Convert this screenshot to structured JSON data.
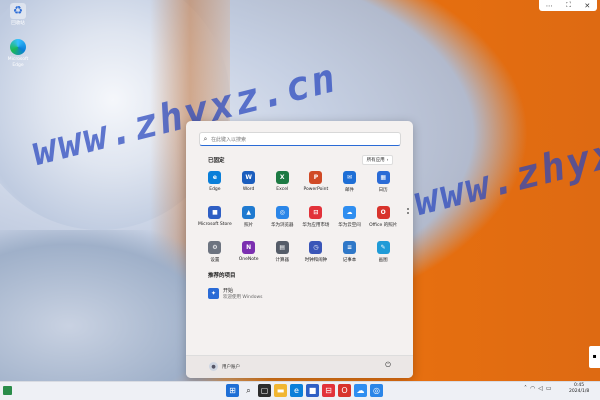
{
  "desktop": {
    "icons": [
      {
        "label": "回收站"
      },
      {
        "label": "Microsoft Edge"
      }
    ],
    "watermark": "www.zhyxz.cn"
  },
  "start_menu": {
    "search_placeholder": "在此键入以搜索",
    "pinned_title": "已固定",
    "all_apps_label": "所有应用",
    "pinned": [
      {
        "label": "Edge",
        "icon": "edge-icon",
        "color": "#0a7fd9",
        "glyph": "e"
      },
      {
        "label": "Word",
        "icon": "word-icon",
        "color": "#1b5ebe",
        "glyph": "W"
      },
      {
        "label": "Excel",
        "icon": "excel-icon",
        "color": "#1d7a43",
        "glyph": "X"
      },
      {
        "label": "PowerPoint",
        "icon": "powerpoint-icon",
        "color": "#d04a26",
        "glyph": "P"
      },
      {
        "label": "邮件",
        "icon": "mail-icon",
        "color": "#1e6fd6",
        "glyph": "✉"
      },
      {
        "label": "日历",
        "icon": "calendar-icon",
        "color": "#2a6bd6",
        "glyph": "▦"
      },
      {
        "label": "Microsoft Store",
        "icon": "store-icon",
        "color": "#2f5fc4",
        "glyph": "■"
      },
      {
        "label": "照片",
        "icon": "photos-icon",
        "color": "#1f7ad0",
        "glyph": "▲"
      },
      {
        "label": "华为浏览器",
        "icon": "huawei-browser-icon",
        "color": "#2b86e8",
        "glyph": "◎"
      },
      {
        "label": "华为应用市场",
        "icon": "huawei-appgallery-icon",
        "color": "#e2323a",
        "glyph": "⊟"
      },
      {
        "label": "华为云空间",
        "icon": "huawei-cloud-icon",
        "color": "#2f8ef0",
        "glyph": "☁"
      },
      {
        "label": "Office 的照片",
        "icon": "office-icon",
        "color": "#d8332c",
        "glyph": "O"
      },
      {
        "label": "设置",
        "icon": "settings-icon",
        "color": "#6d7480",
        "glyph": "⚙"
      },
      {
        "label": "OneNote",
        "icon": "onenote-icon",
        "color": "#7b2fb0",
        "glyph": "N"
      },
      {
        "label": "计算器",
        "icon": "calculator-icon",
        "color": "#555c68",
        "glyph": "▤"
      },
      {
        "label": "时钟和闹钟",
        "icon": "clock-icon",
        "color": "#3a56b8",
        "glyph": "◷"
      },
      {
        "label": "记事本",
        "icon": "notepad-icon",
        "color": "#2f78c8",
        "glyph": "≡"
      },
      {
        "label": "画图",
        "icon": "paint-icon",
        "color": "#1f9bd7",
        "glyph": "✎"
      }
    ],
    "recommended_title": "推荐的项目",
    "recommended": {
      "title": "开始",
      "subtitle": "欢迎使用 Windows"
    },
    "user_name": "用户账户"
  },
  "taskbar": {
    "clock_time": "0:45",
    "clock_date": "2024/1/8"
  }
}
